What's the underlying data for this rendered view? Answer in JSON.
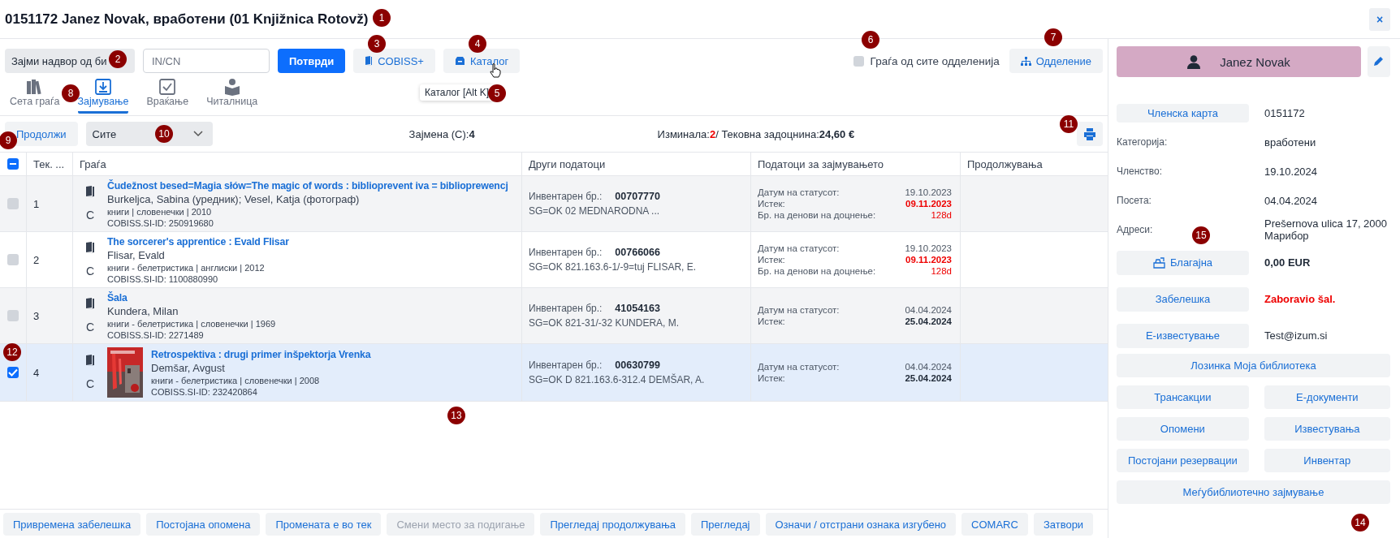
{
  "window": {
    "title": "0151172 Janez Novak, вработени (01 Knjižnica Rotovž)",
    "close": "×"
  },
  "toolbar": {
    "outside_loan": "Зајми надвор од би",
    "input_placeholder": "IN/CN",
    "confirm": "Потврди",
    "cobiss": "COBISS+",
    "catalog": "Каталог",
    "tooltip": "Каталог [Alt K]",
    "all_departments": {
      "label": "Граѓа од сите одделенија",
      "checked": false
    },
    "department": "Одделение"
  },
  "tabs": [
    {
      "label": "Сета граѓа",
      "selected": false,
      "kind": "books"
    },
    {
      "label": "Зајмување",
      "selected": true,
      "kind": "loan"
    },
    {
      "label": "Враќање",
      "selected": false,
      "kind": "return"
    },
    {
      "label": "Читалница",
      "selected": false,
      "kind": "reading"
    }
  ],
  "filter": {
    "extend": "Продолжи",
    "select": "Сите",
    "loaned_label": "Зајмена (C):",
    "loaned_value": "4",
    "overdue_label": "Изминала:",
    "overdue_value": "2",
    "debt_label": "/ Тековна задоцнина:",
    "debt_value": "24,60 €"
  },
  "table": {
    "select_all": {
      "indeterminate": true
    },
    "columns": [
      "Тек. ...",
      "Граѓа",
      "Други податоци",
      "Податоци за зајмувањето",
      "Продолжувања"
    ],
    "rows": [
      {
        "selected": false,
        "number": "1",
        "type": "C",
        "cover": false,
        "title": "Čudežnost besed=Magia słów=The magic of words : biblioprevent iva = biblioprewencj",
        "author": "Burkeljca, Sabina (уредник); Vesel, Katja (фотограф)",
        "meta": "книги | словенечки | 2010",
        "cobiss_id": "COBISS.SI-ID: 250919680",
        "inventory_label": "Инвентарен бр.:",
        "inventory": "00707770",
        "signature": "SG=OK 02 MEDNARODNA ...",
        "loan": [
          {
            "label": "Датум на статусот:",
            "value": "19.10.2023",
            "bold": false,
            "alert": false
          },
          {
            "label": "Истек:",
            "value": "09.11.2023",
            "bold": true,
            "alert": true
          },
          {
            "label": "Бр. на денови на доцнење:",
            "value": "128d",
            "bold": false,
            "alert": true
          }
        ]
      },
      {
        "selected": false,
        "number": "2",
        "type": "C",
        "cover": false,
        "title": "The sorcerer's apprentice : Evald Flisar",
        "author": "Flisar, Evald",
        "meta": "книги - белетристика | англиски | 2012",
        "cobiss_id": "COBISS.SI-ID: 1100880990",
        "inventory_label": "Инвентарен бр.:",
        "inventory": "00766066",
        "signature": "SG=OK 821.163.6-1/-9=tuj FLISAR, E.",
        "loan": [
          {
            "label": "Датум на статусот:",
            "value": "19.10.2023",
            "bold": false,
            "alert": false
          },
          {
            "label": "Истек:",
            "value": "09.11.2023",
            "bold": true,
            "alert": true
          },
          {
            "label": "Бр. на денови на доцнење:",
            "value": "128d",
            "bold": false,
            "alert": true
          }
        ]
      },
      {
        "selected": false,
        "number": "3",
        "type": "C",
        "cover": false,
        "title": "Šala",
        "author": "Kundera, Milan",
        "meta": "книги - белетристика | словенечки | 1969",
        "cobiss_id": "COBISS.SI-ID: 2271489",
        "inventory_label": "Инвентарен бр.:",
        "inventory": "41054163",
        "signature": "SG=OK 821-31/-32 KUNDERA, M.",
        "loan": [
          {
            "label": "Датум на статусот:",
            "value": "04.04.2024",
            "bold": false,
            "alert": false
          },
          {
            "label": "Истек:",
            "value": "25.04.2024",
            "bold": true,
            "alert": false
          }
        ]
      },
      {
        "selected": true,
        "number": "4",
        "type": "C",
        "cover": true,
        "title": "Retrospektiva : drugi primer inšpektorja Vrenka",
        "author": "Demšar, Avgust",
        "meta": "книги - белетристика | словенечки | 2008",
        "cobiss_id": "COBISS.SI-ID: 232420864",
        "inventory_label": "Инвентарен бр.:",
        "inventory": "00630799",
        "signature": "SG=OK D 821.163.6-312.4 DEMŠAR, A.",
        "loan": [
          {
            "label": "Датум на статусот:",
            "value": "04.04.2024",
            "bold": false,
            "alert": false
          },
          {
            "label": "Истек:",
            "value": "25.04.2024",
            "bold": true,
            "alert": false
          }
        ]
      }
    ]
  },
  "footer": [
    {
      "label": "Привремена забелешка",
      "disabled": false
    },
    {
      "label": "Постојана опомена",
      "disabled": false
    },
    {
      "label": "Промената е во тек",
      "disabled": false
    },
    {
      "label": "Смени место за подигање",
      "disabled": true
    },
    {
      "label": "Прегледај продолжувања",
      "disabled": false
    },
    {
      "label": "Прегледај",
      "disabled": false
    },
    {
      "label": "Означи / отстрани ознака изгубено",
      "disabled": false
    },
    {
      "label": "COMARC",
      "disabled": false
    },
    {
      "label": "Затвори",
      "disabled": false
    }
  ],
  "member": {
    "name": "Janez Novak",
    "info": [
      {
        "kind": "button",
        "label": "Членска карта",
        "value": "0151172",
        "bold": false,
        "alert": false
      },
      {
        "kind": "label",
        "label": "Категорија:",
        "value": "вработени",
        "bold": false,
        "alert": false
      },
      {
        "kind": "label",
        "label": "Членство:",
        "value": "19.10.2024",
        "bold": false,
        "alert": false
      },
      {
        "kind": "label",
        "label": "Посета:",
        "value": "04.04.2024",
        "bold": false,
        "alert": false
      },
      {
        "kind": "label",
        "label": "Адреси:",
        "value": "Prešernova ulica 17, 2000 Марибор",
        "bold": false,
        "alert": false
      },
      {
        "kind": "icon-button",
        "label": "Благајна",
        "value": "0,00 EUR",
        "bold": true,
        "alert": false
      },
      {
        "kind": "button",
        "label": "Забелешка",
        "value": "Zaboravio šal.",
        "bold": true,
        "alert": true
      },
      {
        "kind": "button",
        "label": "Е-известување",
        "value": "Test@izum.si",
        "bold": false,
        "alert": false
      }
    ],
    "actions": [
      {
        "label": "Лозинка Моја библиотека",
        "wide": true
      },
      {
        "label": "Трансакции",
        "wide": false
      },
      {
        "label": "Е-документи",
        "wide": false
      },
      {
        "label": "Опомени",
        "wide": false
      },
      {
        "label": "Известувања",
        "wide": false
      },
      {
        "label": "Постојани резервации",
        "wide": false
      },
      {
        "label": "Инвентар",
        "wide": false
      },
      {
        "label": "Меѓубиблиотечно зајмување",
        "wide": true
      }
    ]
  },
  "callouts": [
    "1",
    "2",
    "3",
    "4",
    "5",
    "6",
    "7",
    "8",
    "9",
    "10",
    "11",
    "12",
    "13",
    "14",
    "15"
  ]
}
